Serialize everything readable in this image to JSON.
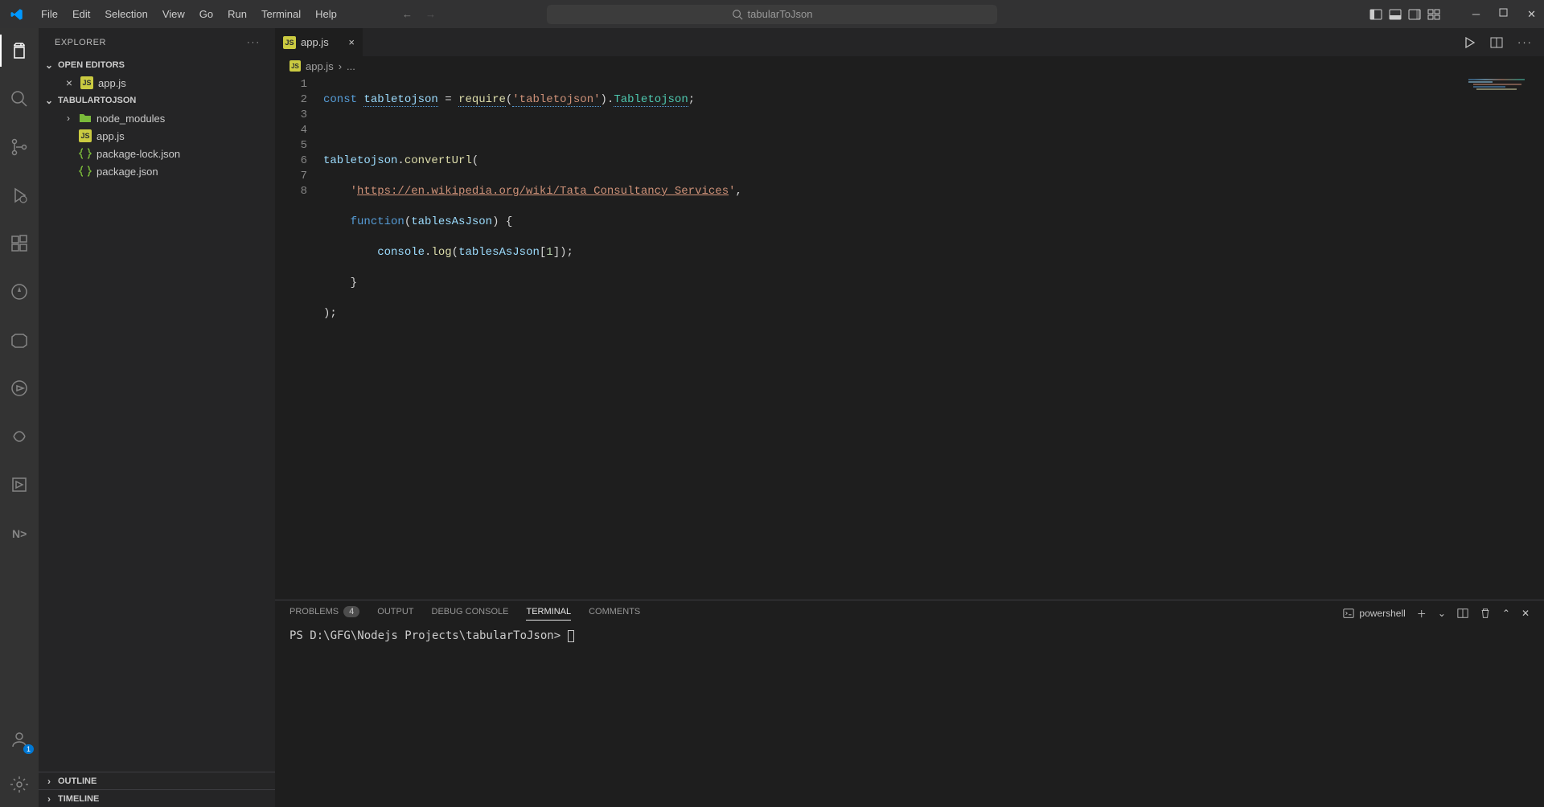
{
  "titlebar": {
    "menus": [
      "File",
      "Edit",
      "Selection",
      "View",
      "Go",
      "Run",
      "Terminal",
      "Help"
    ],
    "search_text": "tabularToJson"
  },
  "activitybar": {
    "account_badge": "1"
  },
  "sidebar": {
    "title": "EXPLORER",
    "open_editors_label": "OPEN EDITORS",
    "open_editor_file": "app.js",
    "project_label": "TABULARTOJSON",
    "files": {
      "node_modules": "node_modules",
      "appjs": "app.js",
      "pkglock": "package-lock.json",
      "pkg": "package.json"
    },
    "outline_label": "OUTLINE",
    "timeline_label": "TIMELINE"
  },
  "tabs": {
    "appjs": "app.js"
  },
  "breadcrumb": {
    "file": "app.js",
    "more": "..."
  },
  "editor": {
    "line_numbers": [
      "1",
      "2",
      "3",
      "4",
      "5",
      "6",
      "7",
      "8"
    ],
    "line1": {
      "kw": "const",
      "sp": " ",
      "var": "tabletojson",
      "eq": " = ",
      "fn": "require",
      "op": "(",
      "str": "'tabletojson'",
      "cp": ").",
      "type": "Tabletojson",
      "end": ";"
    },
    "line3": {
      "var": "tabletojson",
      "dot": ".",
      "fn": "convertUrl",
      "op": "("
    },
    "line4": {
      "q1": "'",
      "url": "https://en.wikipedia.org/wiki/Tata_Consultancy_Services",
      "q2": "'",
      "comma": ","
    },
    "line5": {
      "kw": "function",
      "op": "(",
      "arg": "tablesAsJson",
      "cp": ") {"
    },
    "line6": {
      "obj": "console",
      "dot": ".",
      "fn": "log",
      "op": "(",
      "arg": "tablesAsJson",
      "br": "[",
      "num": "1",
      "br2": "]);"
    },
    "line7": {
      "close": "}"
    },
    "line8": {
      "close": ");"
    }
  },
  "panel": {
    "tabs": {
      "problems": "PROBLEMS",
      "problems_count": "4",
      "output": "OUTPUT",
      "debug": "DEBUG CONSOLE",
      "terminal": "TERMINAL",
      "comments": "COMMENTS"
    },
    "term_kind": "powershell",
    "prompt": "PS D:\\GFG\\Nodejs Projects\\tabularToJson> "
  }
}
